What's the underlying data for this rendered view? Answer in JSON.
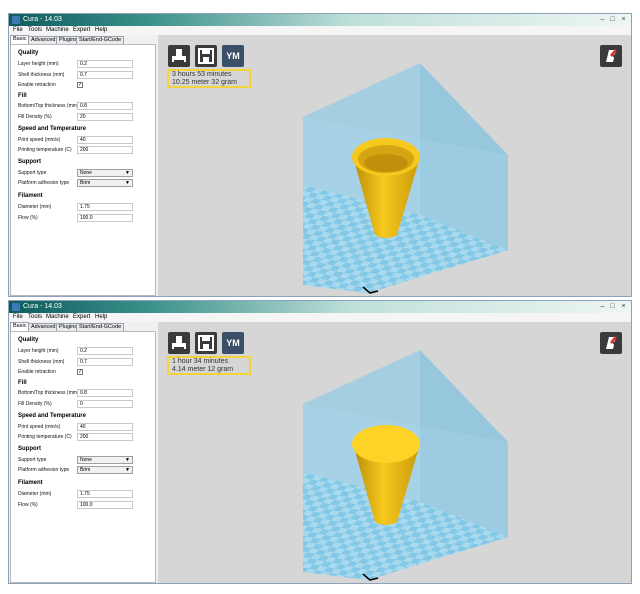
{
  "windows": [
    {
      "title": "Cura - 14.03",
      "menu": [
        "File",
        "Tools",
        "Machine",
        "Expert",
        "Help"
      ],
      "tabs": [
        "Basic",
        "Advanced",
        "Plugins",
        "Start/End-GCode"
      ],
      "quality": {
        "heading": "Quality",
        "layer_height_label": "Layer height (mm)",
        "layer_height": "0.2",
        "shell_thickness_label": "Shell thickness (mm)",
        "shell_thickness": "0.7",
        "retraction_label": "Enable retraction",
        "retraction_mark": "✓"
      },
      "fill": {
        "heading": "Fill",
        "bottom_top_label": "Bottom/Top thickness (mm)",
        "bottom_top": "0.8",
        "density_label": "Fill Density (%)",
        "density": "20"
      },
      "speed": {
        "heading": "Speed and Temperature",
        "print_speed_label": "Print speed (mm/s)",
        "print_speed": "40",
        "temp_label": "Printing temperature (C)",
        "temp": "200"
      },
      "support": {
        "heading": "Support",
        "type_label": "Support type",
        "type": "None",
        "adhesion_label": "Platform adhesion type",
        "adhesion": "Brim"
      },
      "filament": {
        "heading": "Filament",
        "diameter_label": "Diameter (mm)",
        "diameter": "1.75",
        "flow_label": "Flow (%)",
        "flow": "100.0"
      },
      "toolbar": {
        "ym_label": "YM"
      },
      "print_info": {
        "time": "3 hours 53 minutes",
        "material": "10.25 meter 32 gram"
      }
    },
    {
      "title": "Cura - 14.03",
      "menu": [
        "File",
        "Tools",
        "Machine",
        "Expert",
        "Help"
      ],
      "tabs": [
        "Basic",
        "Advanced",
        "Plugins",
        "Start/End-GCode"
      ],
      "quality": {
        "heading": "Quality",
        "layer_height_label": "Layer height (mm)",
        "layer_height": "0.2",
        "shell_thickness_label": "Shell thickness (mm)",
        "shell_thickness": "0.7",
        "retraction_label": "Enable retraction",
        "retraction_mark": "✓"
      },
      "fill": {
        "heading": "Fill",
        "bottom_top_label": "Bottom/Top thickness (mm)",
        "bottom_top": "0.8",
        "density_label": "Fill Density (%)",
        "density": "0"
      },
      "speed": {
        "heading": "Speed and Temperature",
        "print_speed_label": "Print speed (mm/s)",
        "print_speed": "40",
        "temp_label": "Printing temperature (C)",
        "temp": "200"
      },
      "support": {
        "heading": "Support",
        "type_label": "Support type",
        "type": "None",
        "adhesion_label": "Platform adhesion type",
        "adhesion": "Brim"
      },
      "filament": {
        "heading": "Filament",
        "diameter_label": "Diameter (mm)",
        "diameter": "1.75",
        "flow_label": "Flow (%)",
        "flow": "100.0"
      },
      "toolbar": {
        "ym_label": "YM"
      },
      "print_info": {
        "time": "1 hour 34 minutes",
        "material": "4.14 meter 12 gram"
      }
    }
  ],
  "colors": {
    "model_yellow": "#f7c81e",
    "build_volume": "#8fc7e0",
    "platform_light": "#a9dbef",
    "platform_dark": "#6fc0e3",
    "highlight_border": "#f4d23a"
  }
}
